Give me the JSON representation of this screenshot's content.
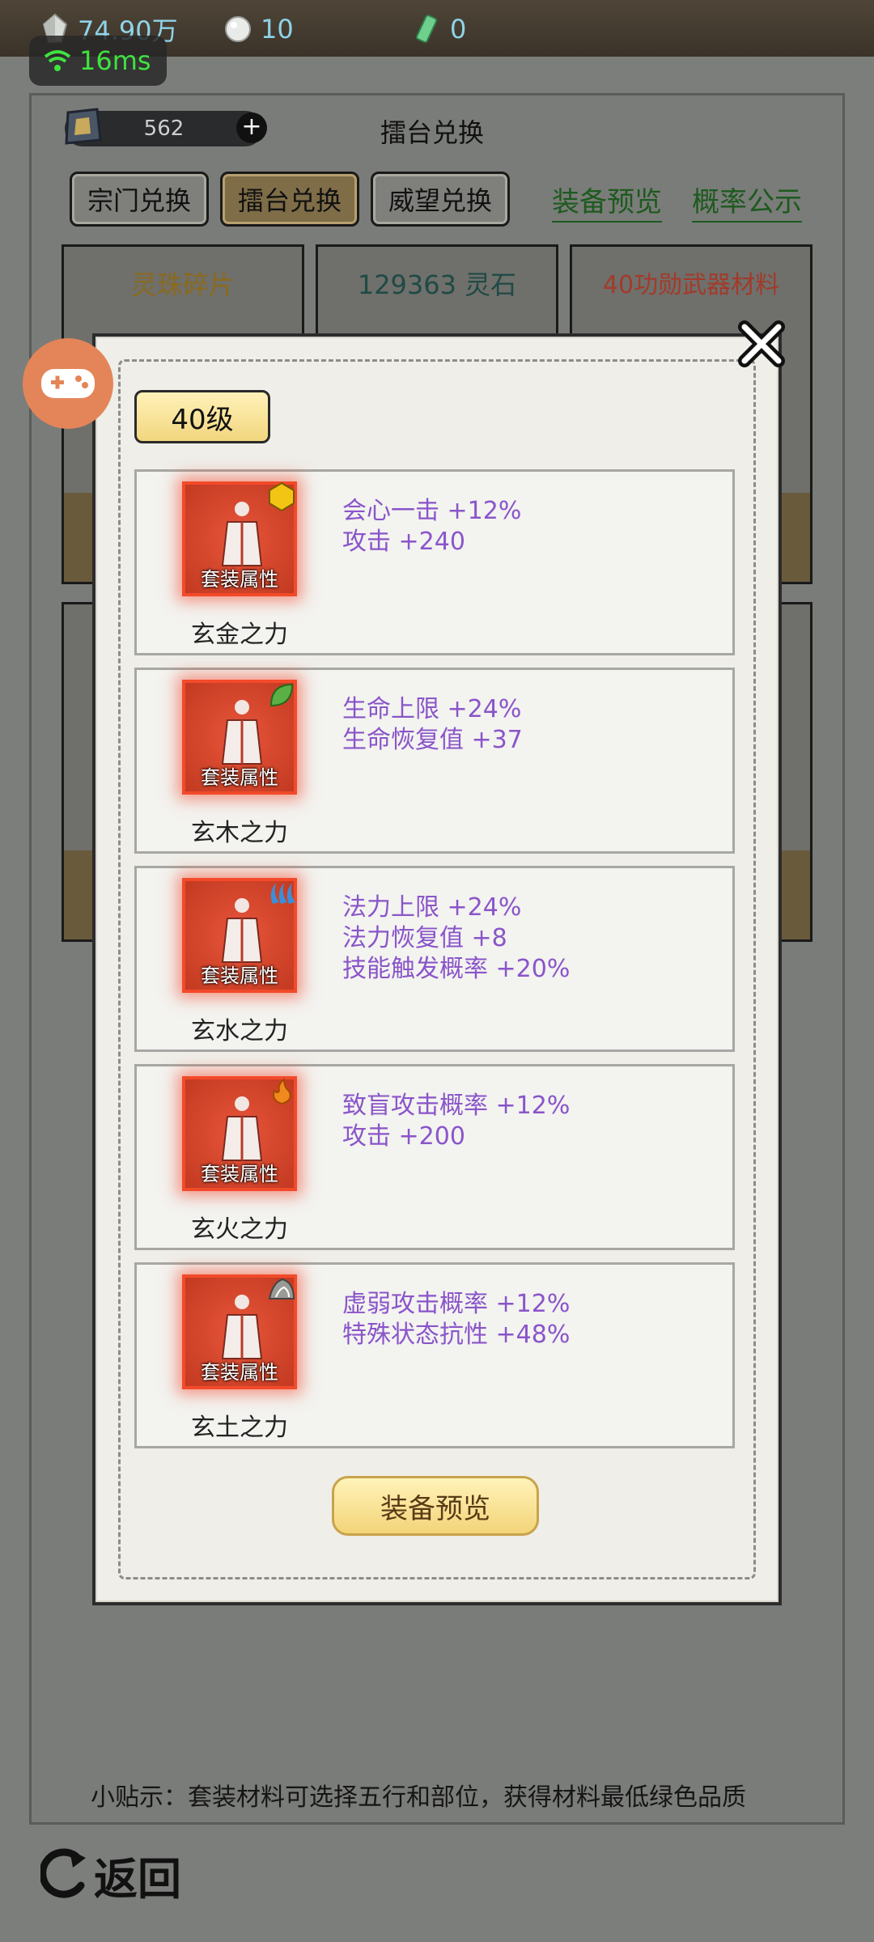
{
  "status_bar": {
    "spirit_stone": "74.90万",
    "pearls": "10",
    "scrolls": "0",
    "ping": "16ms"
  },
  "header": {
    "token_count": "562",
    "title": "擂台兑换"
  },
  "tabs": [
    {
      "label": "宗门兑换"
    },
    {
      "label": "擂台兑换",
      "active": true
    },
    {
      "label": "威望兑换"
    }
  ],
  "links": {
    "equipment_preview": "装备预览",
    "probability": "概率公示"
  },
  "cards": [
    {
      "title": "灵珠碎片",
      "color": "#8a6a1f"
    },
    {
      "title": "129363 灵石",
      "color": "#1f4a45"
    },
    {
      "title": "40功勋武器材料",
      "color": "#a33a2a"
    }
  ],
  "modal": {
    "level": "40级",
    "icon_tag": "套装属性",
    "sets": [
      {
        "name": "玄金之力",
        "element": "metal-icon",
        "stats": [
          "会心一击 +12%",
          "攻击 +240"
        ]
      },
      {
        "name": "玄木之力",
        "element": "wood-icon",
        "stats": [
          "生命上限 +24%",
          "生命恢复值 +37"
        ]
      },
      {
        "name": "玄水之力",
        "element": "water-icon",
        "stats": [
          "法力上限 +24%",
          "法力恢复值 +8",
          "技能触发概率 +20%"
        ]
      },
      {
        "name": "玄火之力",
        "element": "fire-icon",
        "stats": [
          "致盲攻击概率 +12%",
          "攻击 +200"
        ]
      },
      {
        "name": "玄土之力",
        "element": "earth-icon",
        "stats": [
          "虚弱攻击概率 +12%",
          "特殊状态抗性 +48%"
        ]
      }
    ],
    "preview_button": "装备预览"
  },
  "tip": "小贴示：套装材料可选择五行和部位，获得材料最低绿色品质",
  "back_button": "返回",
  "colors": {
    "stat_text": "#8a55c9",
    "link_green": "#1d5a1f",
    "ping_green": "#3fe23f"
  }
}
